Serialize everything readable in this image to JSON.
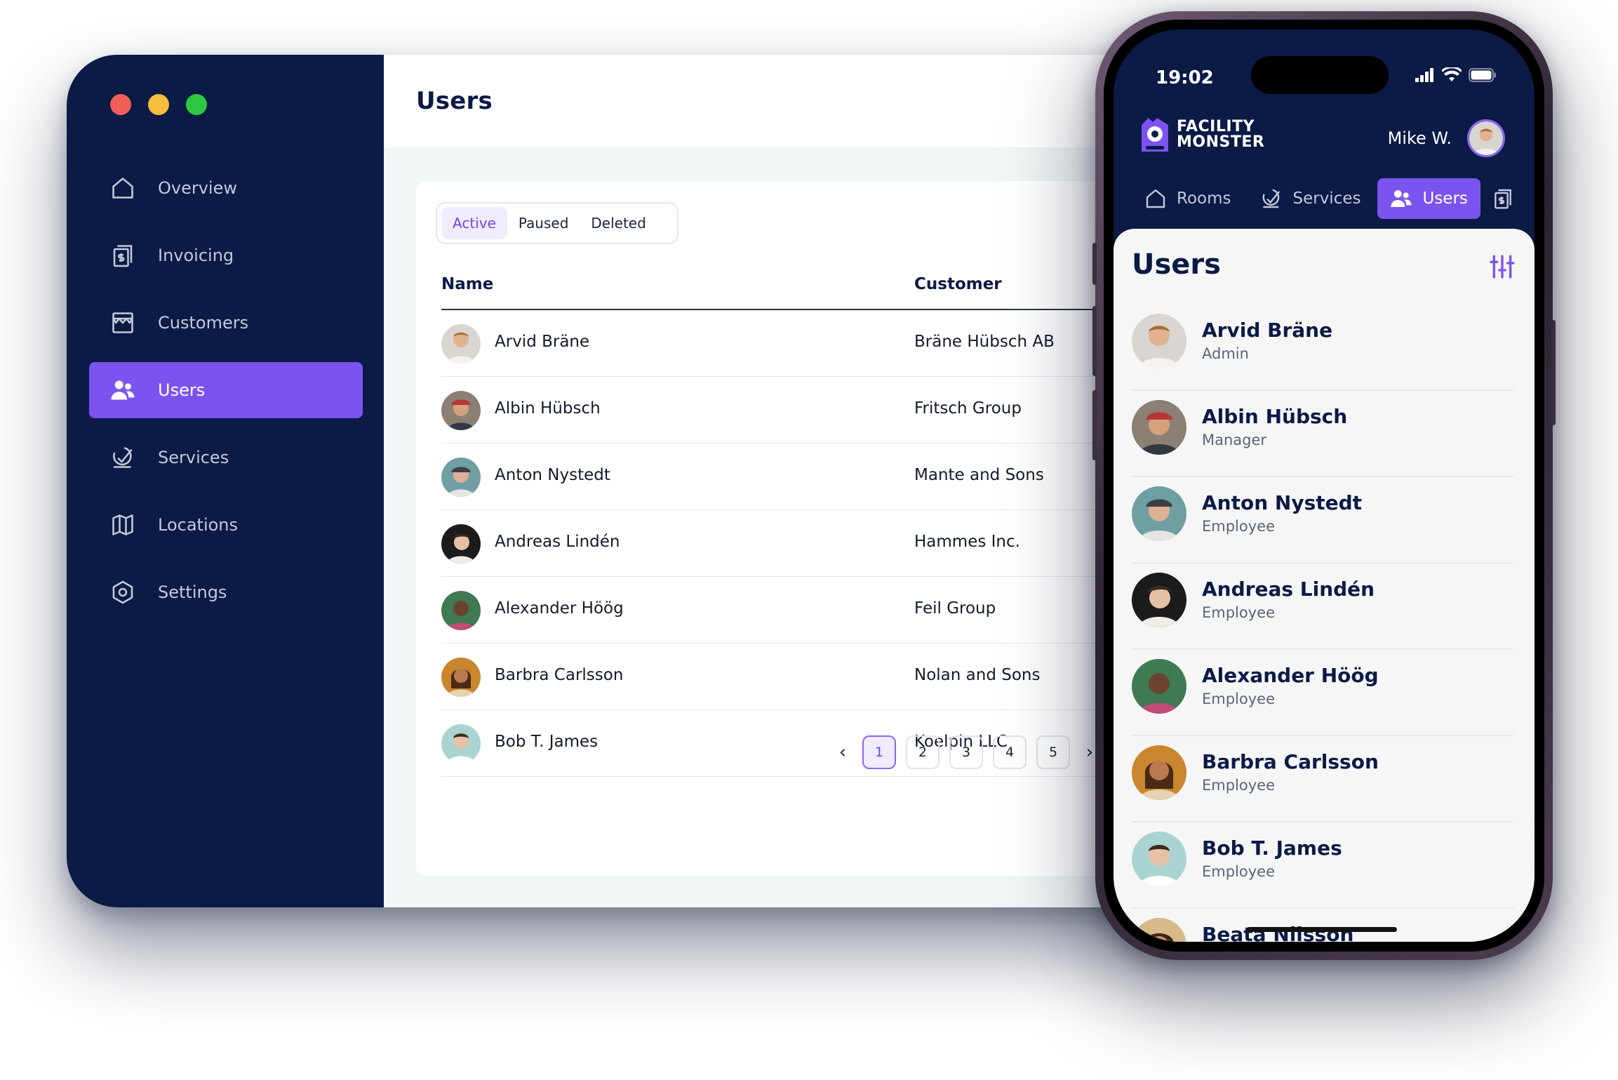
{
  "desktop": {
    "page_title": "Users",
    "traffic_lights": {
      "close": "#ef5f57",
      "minimize": "#f4bd3b",
      "maximize": "#2ec840"
    },
    "nav": [
      {
        "label": "Overview",
        "icon": "home-icon",
        "active": false
      },
      {
        "label": "Invoicing",
        "icon": "invoice-icon",
        "active": false
      },
      {
        "label": "Customers",
        "icon": "store-icon",
        "active": false
      },
      {
        "label": "Users",
        "icon": "users-icon",
        "active": true
      },
      {
        "label": "Services",
        "icon": "services-icon",
        "active": false
      },
      {
        "label": "Locations",
        "icon": "map-icon",
        "active": false
      },
      {
        "label": "Settings",
        "icon": "settings-icon",
        "active": false
      }
    ],
    "filter_tabs": [
      {
        "label": "Active",
        "selected": true
      },
      {
        "label": "Paused",
        "selected": false
      },
      {
        "label": "Deleted",
        "selected": false
      }
    ],
    "columns": {
      "name": "Name",
      "customer": "Customer"
    },
    "rows": [
      {
        "name": "Arvid Bräne",
        "customer": "Bräne Hübsch AB"
      },
      {
        "name": "Albin Hübsch",
        "customer": "Fritsch Group"
      },
      {
        "name": "Anton Nystedt",
        "customer": "Mante and Sons"
      },
      {
        "name": "Andreas Lindén",
        "customer": "Hammes Inc."
      },
      {
        "name": "Alexander Höög",
        "customer": "Feil Group"
      },
      {
        "name": "Barbra Carlsson",
        "customer": "Nolan and Sons"
      },
      {
        "name": "Bob T. James",
        "customer": "Koelpin LLC"
      }
    ],
    "pagination": {
      "pages": [
        "1",
        "2",
        "3",
        "4",
        "5"
      ],
      "current": "1",
      "prev": "‹",
      "next": "›"
    }
  },
  "phone": {
    "status": {
      "time": "19:02"
    },
    "brand": {
      "line1": "FACILITY",
      "line2": "MONSTER"
    },
    "user_name": "Mike W.",
    "tabs": [
      {
        "label": "Rooms",
        "icon": "home-icon",
        "active": false
      },
      {
        "label": "Services",
        "icon": "services-icon",
        "active": false
      },
      {
        "label": "Users",
        "icon": "users-icon",
        "active": true
      }
    ],
    "sheet_title": "Users",
    "users": [
      {
        "name": "Arvid Bräne",
        "role": "Admin"
      },
      {
        "name": "Albin Hübsch",
        "role": "Manager"
      },
      {
        "name": "Anton Nystedt",
        "role": "Employee"
      },
      {
        "name": "Andreas Lindén",
        "role": "Employee"
      },
      {
        "name": "Alexander Höög",
        "role": "Employee"
      },
      {
        "name": "Barbra Carlsson",
        "role": "Employee"
      },
      {
        "name": "Bob T. James",
        "role": "Employee"
      },
      {
        "name": "Beata Nilsson",
        "role": ""
      }
    ]
  },
  "colors": {
    "navy": "#0c1a46",
    "accent": "#7b54ef"
  }
}
